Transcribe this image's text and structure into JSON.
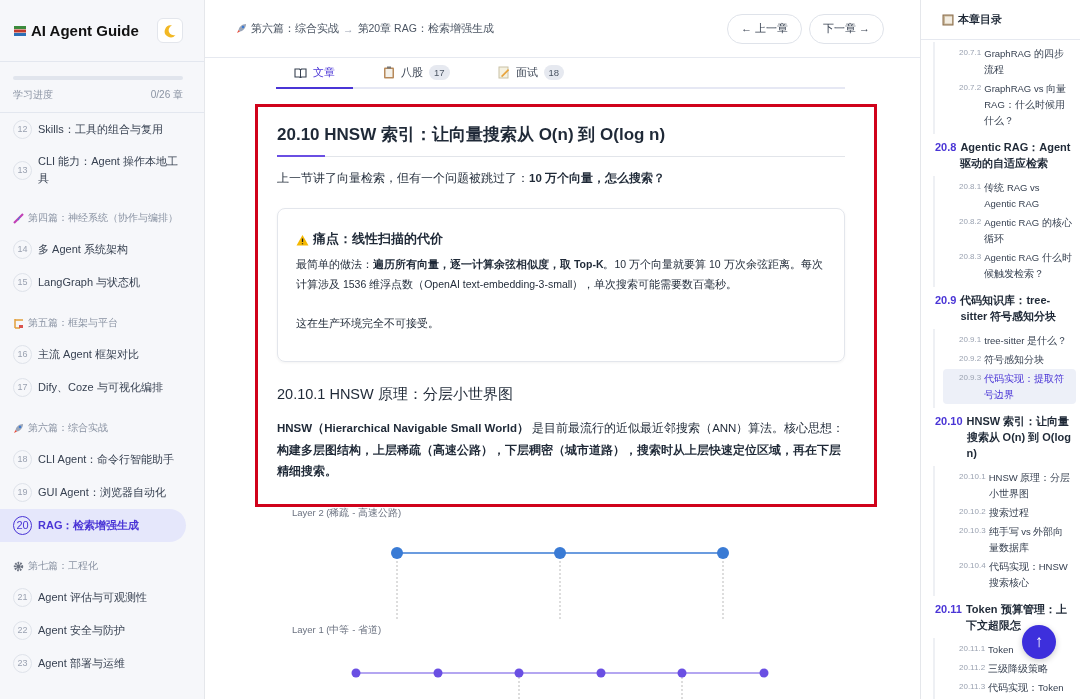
{
  "sidebar": {
    "title": "AI Agent Guide",
    "progress": {
      "label": "学习进度",
      "count": "0/26 章",
      "level": 0
    },
    "entries": [
      {
        "kind": "chapter",
        "number": "12",
        "title": "Skills：工具的组合与复用",
        "selected": false
      },
      {
        "kind": "chapter",
        "number": "13",
        "title": "CLI 能力：Agent 操作本地工具",
        "selected": false
      },
      {
        "kind": "part",
        "title": "第四篇：神经系统（协作与编排）"
      },
      {
        "kind": "chapter",
        "number": "14",
        "title": "多 Agent 系统架构",
        "selected": false
      },
      {
        "kind": "chapter",
        "number": "15",
        "title": "LangGraph 与状态机",
        "selected": false
      },
      {
        "kind": "part",
        "title": "第五篇：框架与平台"
      },
      {
        "kind": "chapter",
        "number": "16",
        "title": "主流 Agent 框架对比",
        "selected": false
      },
      {
        "kind": "chapter",
        "number": "17",
        "title": "Dify、Coze 与可视化编排",
        "selected": false
      },
      {
        "kind": "part",
        "title": "第六篇：综合实战"
      },
      {
        "kind": "chapter",
        "number": "18",
        "title": "CLI Agent：命令行智能助手",
        "selected": false
      },
      {
        "kind": "chapter",
        "number": "19",
        "title": "GUI Agent：浏览器自动化",
        "selected": false
      },
      {
        "kind": "chapter",
        "number": "20",
        "title": "RAG：检索增强生成",
        "selected": true
      },
      {
        "kind": "part",
        "title": "第七篇：工程化"
      },
      {
        "kind": "chapter",
        "number": "21",
        "title": "Agent 评估与可观测性",
        "selected": false
      },
      {
        "kind": "chapter",
        "number": "22",
        "title": "Agent 安全与防护",
        "selected": false
      },
      {
        "kind": "chapter",
        "number": "23",
        "title": "Agent 部署与运维",
        "selected": false
      }
    ]
  },
  "header": {
    "breadcrumb": [
      {
        "text": "第六篇：综合实战"
      },
      {
        "text": "第20章 RAG：检索增强生成"
      }
    ],
    "separator": "→",
    "buttons": [
      {
        "label": "← 上一章"
      },
      {
        "label": "下一章 →"
      }
    ]
  },
  "tabs": [
    {
      "label": "文章",
      "selected": true
    },
    {
      "label": "八股",
      "count": "17",
      "selected": false
    },
    {
      "label": "面试",
      "count": "18",
      "selected": false
    }
  ],
  "article": {
    "highlighted": true,
    "title": "20.10 HNSW 索引：让向量搜索从 O(n) 到 O(log n)",
    "intro": "上一节讲了向量检索，但有一个问题被跳过了：**10 万个向量，怎么搜索？**",
    "callout": {
      "title": "痛点：线性扫描的代价",
      "paragraphs": [
        "最简单的做法：**遍历所有向量，逐一计算余弦相似度，取 Top-K**。10 万个向量就要算 10 万次余弦距离。每次计算涉及 1536 维浮点数（OpenAI text-embedding-3-small），单次搜索可能需要数百毫秒。",
        "这在生产环境完全不可接受。"
      ]
    },
    "subtitle": "20.10.1 HNSW 原理：分层小世界图",
    "body": "**HNSW（Hierarchical Navigable Small World）** 是目前最流行的近似最近邻搜索（ANN）算法。核心思想：**构建多层图结构，上层稀疏（高速公路），下层稠密（城市道路），搜索时从上层快速定位区域，再在下层精细搜索。**"
  },
  "diagram": {
    "layers": [
      {
        "kind": "sparse",
        "label": "Layer 2 (稀疏 - 高速公路)",
        "color": "#3a7bd5"
      },
      {
        "kind": "medium",
        "label": "Layer 1 (中等 - 省道)",
        "color": "#6a4fe3"
      }
    ]
  },
  "toc": {
    "title": "本章目录",
    "sections": [
      {
        "children": [
          {
            "number": "20.7.1",
            "title": "GraphRAG 的四步流程",
            "selected": false
          },
          {
            "number": "20.7.2",
            "title": "GraphRAG vs 向量 RAG：什么时候用什么？",
            "selected": false
          }
        ]
      },
      {
        "number": "20.8",
        "title": "Agentic RAG：Agent 驱动的自适应检索",
        "children": [
          {
            "number": "20.8.1",
            "title": "传统 RAG vs Agentic RAG",
            "selected": false
          },
          {
            "number": "20.8.2",
            "title": "Agentic RAG 的核心循环",
            "selected": false
          },
          {
            "number": "20.8.3",
            "title": "Agentic RAG 什么时候触发检索？",
            "selected": false
          }
        ]
      },
      {
        "number": "20.9",
        "title": "代码知识库：tree-sitter 符号感知分块",
        "children": [
          {
            "number": "20.9.1",
            "title": "tree-sitter 是什么？",
            "selected": false
          },
          {
            "number": "20.9.2",
            "title": "符号感知分块",
            "selected": false
          },
          {
            "number": "20.9.3",
            "title": "代码实现：提取符号边界",
            "selected": true
          }
        ]
      },
      {
        "number": "20.10",
        "title": "HNSW 索引：让向量搜索从 O(n) 到 O(log n)",
        "children": [
          {
            "number": "20.10.1",
            "title": "HNSW 原理：分层小世界图",
            "selected": false
          },
          {
            "number": "20.10.2",
            "title": "搜索过程",
            "selected": false
          },
          {
            "number": "20.10.3",
            "title": "纯手写 vs 外部向量数据库",
            "selected": false
          },
          {
            "number": "20.10.4",
            "title": "代码实现：HNSW 搜索核心",
            "selected": false
          }
        ]
      },
      {
        "number": "20.11",
        "title": "Token 预算管理：上下文超限怎",
        "children": [
          {
            "number": "20.11.1",
            "title": "Token",
            "selected": false
          },
          {
            "number": "20.11.2",
            "title": "三级降级策略",
            "selected": false
          },
          {
            "number": "20.11.3",
            "title": "代码实现：Token",
            "selected": false
          }
        ]
      }
    ]
  },
  "scroll_top": {
    "label": "↑"
  }
}
